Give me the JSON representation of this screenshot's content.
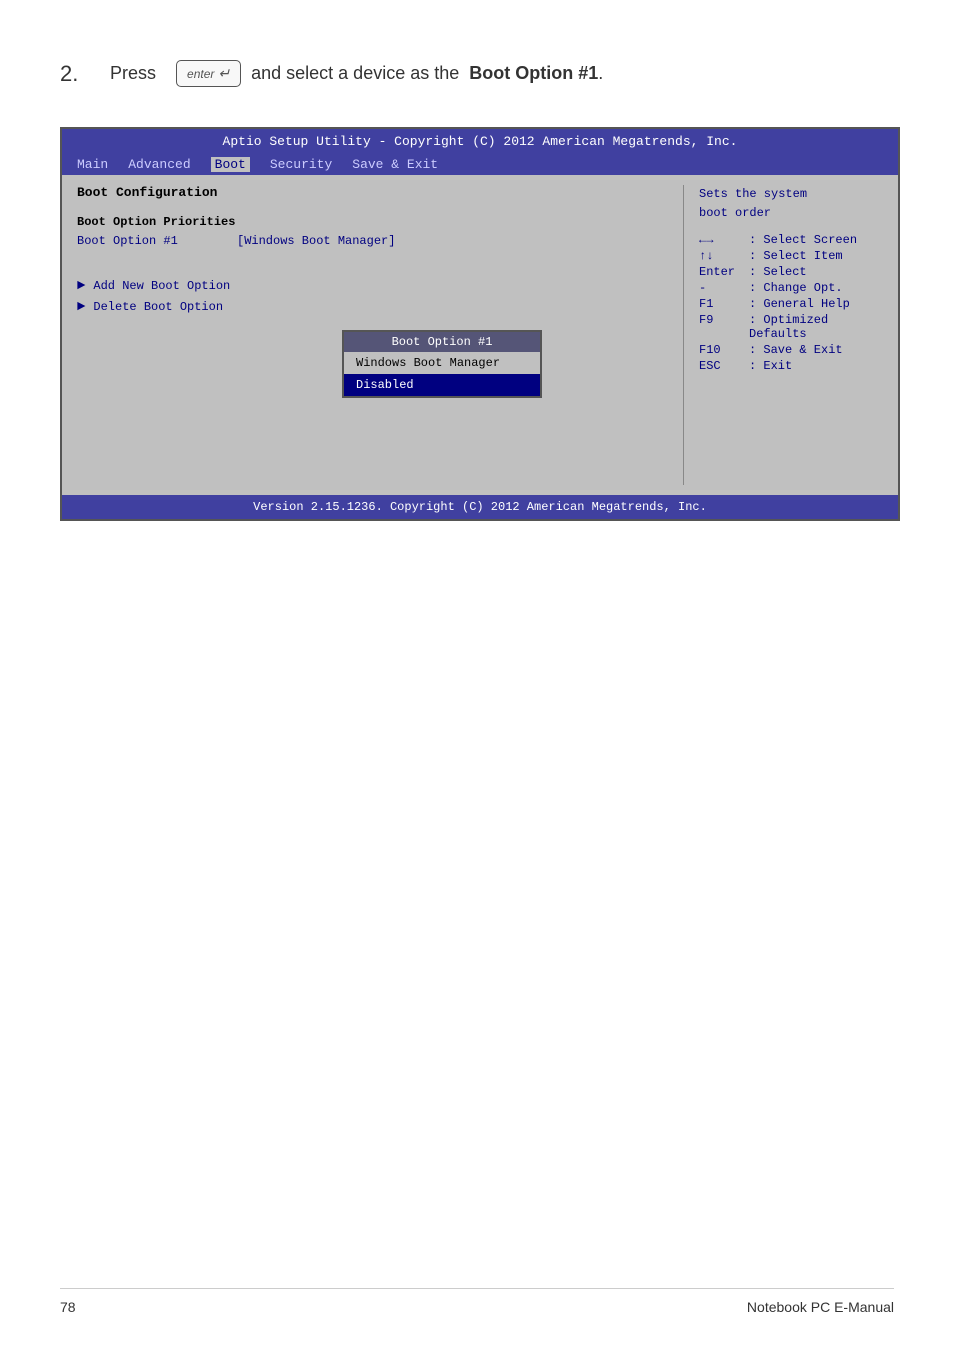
{
  "step": {
    "number": "2.",
    "press_label": "Press",
    "enter_key_label": "enter",
    "instruction_text": "and select a device as the",
    "bold_part": "Boot Option #1",
    "enter_symbol": "↵"
  },
  "bios": {
    "header": "Aptio Setup Utility - Copyright (C) 2012 American Megatrends, Inc.",
    "nav": {
      "items": [
        "Main",
        "Advanced",
        "Boot",
        "Security",
        "Save & Exit"
      ],
      "active": "Boot"
    },
    "left": {
      "section_title": "Boot Configuration",
      "subsection_title": "Boot Option Priorities",
      "boot_option_label": "Boot Option #1",
      "boot_option_value": "[Windows Boot Manager]",
      "actions": [
        "Add New Boot Option",
        "Delete Boot Option"
      ]
    },
    "dropdown": {
      "title": "Boot Option #1",
      "items": [
        "Windows Boot Manager",
        "Disabled"
      ],
      "highlighted_index": 1
    },
    "right": {
      "help_text": "Sets the system\nboot order",
      "key_hints": [
        {
          "key": "←→",
          "desc": ": Select Screen"
        },
        {
          "key": "↑↓",
          "desc": ": Select Item"
        },
        {
          "key": "Enter",
          "desc": ": Select"
        },
        {
          "key": "-",
          "desc": ": Change Opt."
        },
        {
          "key": "F1",
          "desc": ": General Help"
        },
        {
          "key": "F9",
          "desc": ": Optimized Defaults"
        },
        {
          "key": "F10",
          "desc": ": Save & Exit"
        },
        {
          "key": "ESC",
          "desc": ": Exit"
        }
      ]
    },
    "footer": "Version 2.15.1236. Copyright (C) 2012 American Megatrends, Inc."
  },
  "page_footer": {
    "page_number": "78",
    "manual_title": "Notebook PC E-Manual"
  }
}
